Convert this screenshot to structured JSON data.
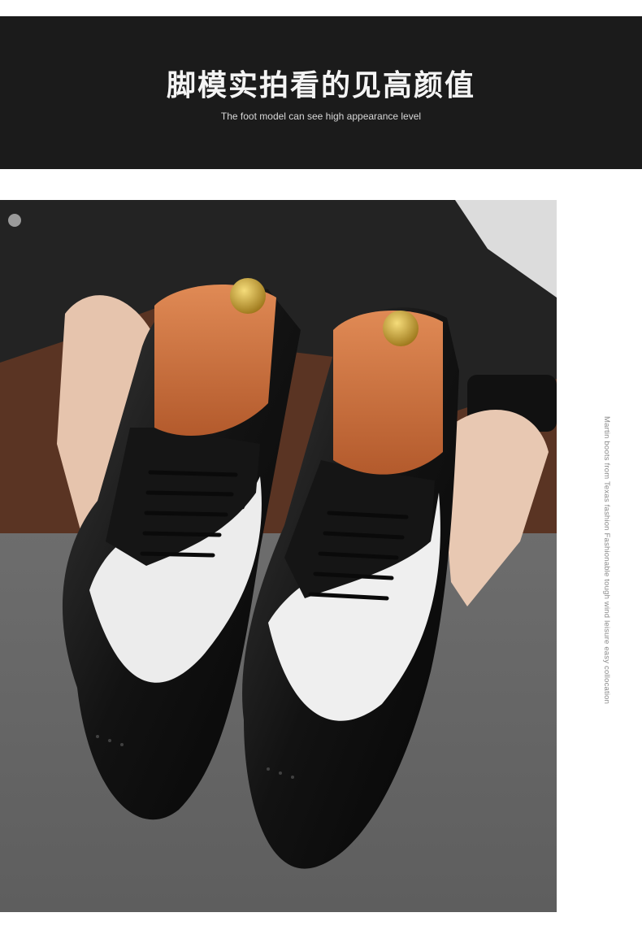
{
  "header": {
    "title": "脚模实拍看的见高颜值",
    "subtitle": "The foot model can see high appearance level"
  },
  "photo": {
    "subject": "black-and-white brogue oxford shoes held in hands",
    "colors": {
      "header_bg": "#1b1b1b",
      "leather_black": "#141414",
      "leather_white": "#eeeeee",
      "insole": "#c9683a",
      "shoe_tree_knob": "#c9a23a",
      "suit": "#232323",
      "floor": "#707070"
    }
  },
  "side_caption": {
    "text": "Martin boots from Texas fashion Fashionable tough wind leisure easy collocation"
  }
}
